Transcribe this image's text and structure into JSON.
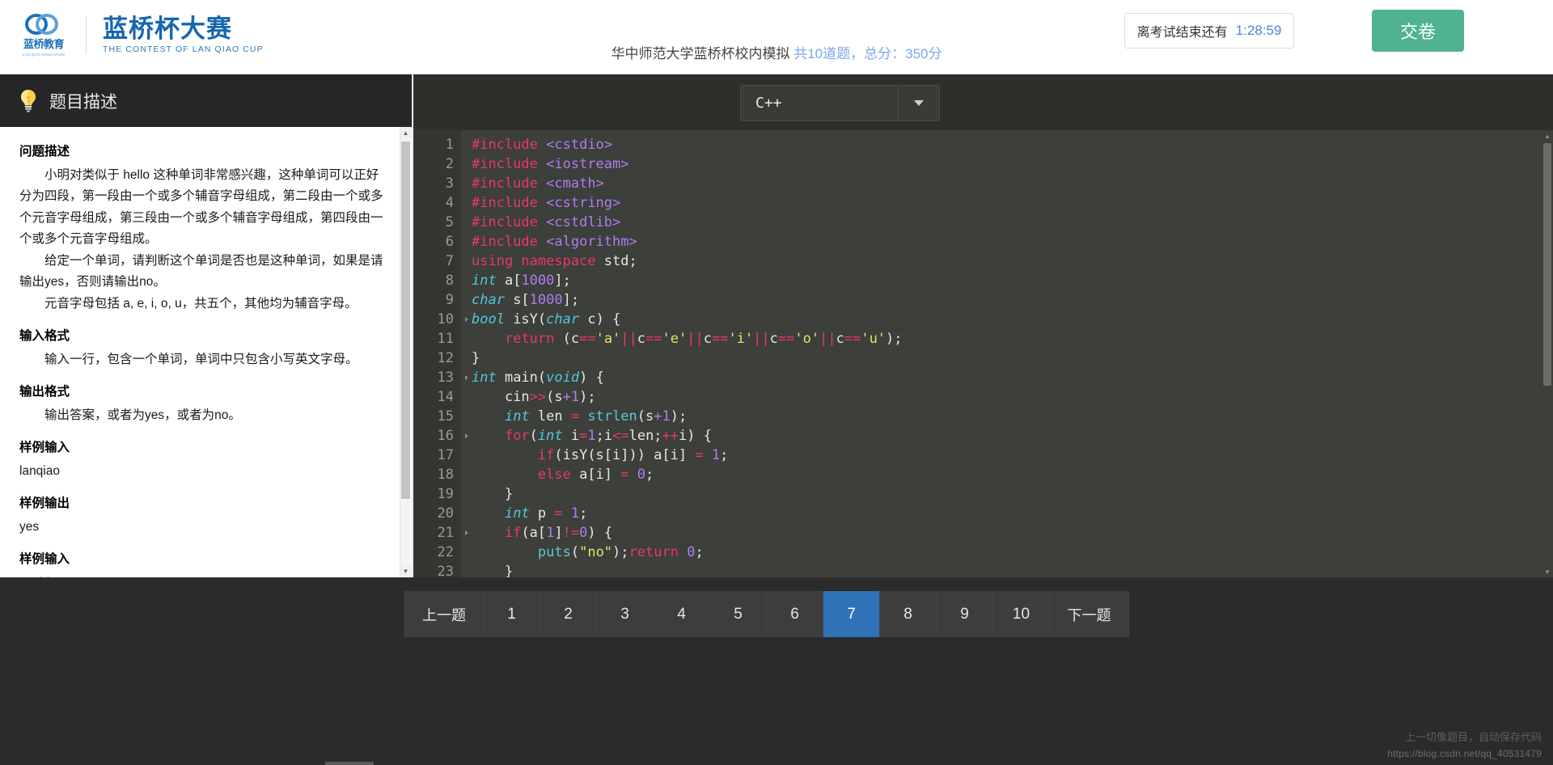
{
  "header": {
    "logo_cn": "蓝桥教育",
    "logo_en_small": "LAN QIAO EDUCATION",
    "brand_title": "蓝桥杯大赛",
    "brand_subtitle": "THE CONTEST OF LAN QIAO CUP",
    "subtitle_main": "华中师范大学蓝桥杯校内模拟",
    "subtitle_meta": "共10道题，总分：350分",
    "timer_label": "离考试结束还有",
    "timer_value": "1:28:59",
    "submit_label": "交卷"
  },
  "left": {
    "panel_title": "题目描述",
    "sections": [
      {
        "title": "问题描述",
        "paras": [
          "小明对类似于 hello 这种单词非常感兴趣，这种单词可以正好分为四段，第一段由一个或多个辅音字母组成，第二段由一个或多个元音字母组成，第三段由一个或多个辅音字母组成，第四段由一个或多个元音字母组成。",
          "给定一个单词，请判断这个单词是否也是这种单词，如果是请输出yes，否则请输出no。",
          "元音字母包括 a, e, i, o, u，共五个，其他均为辅音字母。"
        ]
      },
      {
        "title": "输入格式",
        "paras": [
          "输入一行，包含一个单词，单词中只包含小写英文字母。"
        ]
      },
      {
        "title": "输出格式",
        "paras": [
          "输出答案，或者为yes，或者为no。"
        ]
      },
      {
        "title": "样例输入",
        "plain": [
          "lanqiao"
        ]
      },
      {
        "title": "样例输出",
        "plain": [
          "yes"
        ]
      },
      {
        "title": "样例输入",
        "plain": [
          "world"
        ]
      }
    ]
  },
  "editor": {
    "language": "C++",
    "lines": [
      {
        "n": 1,
        "fold": false,
        "tokens": [
          {
            "c": "k",
            "t": "#include"
          },
          {
            "c": "p",
            "t": " "
          },
          {
            "c": "h",
            "t": "<cstdio>"
          }
        ]
      },
      {
        "n": 2,
        "fold": false,
        "tokens": [
          {
            "c": "k",
            "t": "#include"
          },
          {
            "c": "p",
            "t": " "
          },
          {
            "c": "h",
            "t": "<iostream>"
          }
        ]
      },
      {
        "n": 3,
        "fold": false,
        "tokens": [
          {
            "c": "k",
            "t": "#include"
          },
          {
            "c": "p",
            "t": " "
          },
          {
            "c": "h",
            "t": "<cmath>"
          }
        ]
      },
      {
        "n": 4,
        "fold": false,
        "tokens": [
          {
            "c": "k",
            "t": "#include"
          },
          {
            "c": "p",
            "t": " "
          },
          {
            "c": "h",
            "t": "<cstring>"
          }
        ]
      },
      {
        "n": 5,
        "fold": false,
        "tokens": [
          {
            "c": "k",
            "t": "#include"
          },
          {
            "c": "p",
            "t": " "
          },
          {
            "c": "h",
            "t": "<cstdlib>"
          }
        ]
      },
      {
        "n": 6,
        "fold": false,
        "tokens": [
          {
            "c": "k",
            "t": "#include"
          },
          {
            "c": "p",
            "t": " "
          },
          {
            "c": "h",
            "t": "<algorithm>"
          }
        ]
      },
      {
        "n": 7,
        "fold": false,
        "tokens": [
          {
            "c": "k",
            "t": "using namespace"
          },
          {
            "c": "p",
            "t": " std;"
          }
        ]
      },
      {
        "n": 8,
        "fold": false,
        "tokens": [
          {
            "c": "t",
            "t": "int"
          },
          {
            "c": "p",
            "t": " a["
          },
          {
            "c": "n",
            "t": "1000"
          },
          {
            "c": "p",
            "t": "];"
          }
        ]
      },
      {
        "n": 9,
        "fold": false,
        "tokens": [
          {
            "c": "t",
            "t": "char"
          },
          {
            "c": "p",
            "t": " s["
          },
          {
            "c": "n",
            "t": "1000"
          },
          {
            "c": "p",
            "t": "];"
          }
        ]
      },
      {
        "n": 10,
        "fold": true,
        "tokens": [
          {
            "c": "t",
            "t": "bool"
          },
          {
            "c": "p",
            "t": " isY("
          },
          {
            "c": "t",
            "t": "char"
          },
          {
            "c": "p",
            "t": " c) {"
          }
        ]
      },
      {
        "n": 11,
        "fold": false,
        "tokens": [
          {
            "c": "p",
            "t": "    "
          },
          {
            "c": "k",
            "t": "return"
          },
          {
            "c": "p",
            "t": " (c"
          },
          {
            "c": "o",
            "t": "=="
          },
          {
            "c": "s",
            "t": "'a'"
          },
          {
            "c": "o",
            "t": "||"
          },
          {
            "c": "p",
            "t": "c"
          },
          {
            "c": "o",
            "t": "=="
          },
          {
            "c": "s",
            "t": "'e'"
          },
          {
            "c": "o",
            "t": "||"
          },
          {
            "c": "p",
            "t": "c"
          },
          {
            "c": "o",
            "t": "=="
          },
          {
            "c": "s",
            "t": "'i'"
          },
          {
            "c": "o",
            "t": "||"
          },
          {
            "c": "p",
            "t": "c"
          },
          {
            "c": "o",
            "t": "=="
          },
          {
            "c": "s",
            "t": "'o'"
          },
          {
            "c": "o",
            "t": "||"
          },
          {
            "c": "p",
            "t": "c"
          },
          {
            "c": "o",
            "t": "=="
          },
          {
            "c": "s",
            "t": "'u'"
          },
          {
            "c": "p",
            "t": ");"
          }
        ]
      },
      {
        "n": 12,
        "fold": false,
        "tokens": [
          {
            "c": "p",
            "t": "}"
          }
        ]
      },
      {
        "n": 13,
        "fold": true,
        "tokens": [
          {
            "c": "t",
            "t": "int"
          },
          {
            "c": "p",
            "t": " main("
          },
          {
            "c": "t",
            "t": "void"
          },
          {
            "c": "p",
            "t": ") {"
          }
        ]
      },
      {
        "n": 14,
        "fold": false,
        "tokens": [
          {
            "c": "p",
            "t": "    cin"
          },
          {
            "c": "o",
            "t": ">>"
          },
          {
            "c": "p",
            "t": "(s"
          },
          {
            "c": "n",
            "t": "+1"
          },
          {
            "c": "p",
            "t": ");"
          }
        ]
      },
      {
        "n": 15,
        "fold": false,
        "tokens": [
          {
            "c": "p",
            "t": "    "
          },
          {
            "c": "t",
            "t": "int"
          },
          {
            "c": "p",
            "t": " len "
          },
          {
            "c": "o",
            "t": "="
          },
          {
            "c": "p",
            "t": " "
          },
          {
            "c": "f",
            "t": "strlen"
          },
          {
            "c": "p",
            "t": "(s"
          },
          {
            "c": "n",
            "t": "+1"
          },
          {
            "c": "p",
            "t": ");"
          }
        ]
      },
      {
        "n": 16,
        "fold": true,
        "tokens": [
          {
            "c": "p",
            "t": "    "
          },
          {
            "c": "k",
            "t": "for"
          },
          {
            "c": "p",
            "t": "("
          },
          {
            "c": "t",
            "t": "int"
          },
          {
            "c": "p",
            "t": " i"
          },
          {
            "c": "o",
            "t": "="
          },
          {
            "c": "n",
            "t": "1"
          },
          {
            "c": "p",
            "t": ";i"
          },
          {
            "c": "o",
            "t": "<="
          },
          {
            "c": "p",
            "t": "len;"
          },
          {
            "c": "o",
            "t": "++"
          },
          {
            "c": "p",
            "t": "i) {"
          }
        ]
      },
      {
        "n": 17,
        "fold": false,
        "tokens": [
          {
            "c": "p",
            "t": "        "
          },
          {
            "c": "k",
            "t": "if"
          },
          {
            "c": "p",
            "t": "(isY(s[i])) a[i] "
          },
          {
            "c": "o",
            "t": "="
          },
          {
            "c": "p",
            "t": " "
          },
          {
            "c": "n",
            "t": "1"
          },
          {
            "c": "p",
            "t": ";"
          }
        ]
      },
      {
        "n": 18,
        "fold": false,
        "tokens": [
          {
            "c": "p",
            "t": "        "
          },
          {
            "c": "k",
            "t": "else"
          },
          {
            "c": "p",
            "t": " a[i] "
          },
          {
            "c": "o",
            "t": "="
          },
          {
            "c": "p",
            "t": " "
          },
          {
            "c": "n",
            "t": "0"
          },
          {
            "c": "p",
            "t": ";"
          }
        ]
      },
      {
        "n": 19,
        "fold": false,
        "tokens": [
          {
            "c": "p",
            "t": "    }"
          }
        ]
      },
      {
        "n": 20,
        "fold": false,
        "tokens": [
          {
            "c": "p",
            "t": "    "
          },
          {
            "c": "t",
            "t": "int"
          },
          {
            "c": "p",
            "t": " p "
          },
          {
            "c": "o",
            "t": "="
          },
          {
            "c": "p",
            "t": " "
          },
          {
            "c": "n",
            "t": "1"
          },
          {
            "c": "p",
            "t": ";"
          }
        ]
      },
      {
        "n": 21,
        "fold": true,
        "tokens": [
          {
            "c": "p",
            "t": "    "
          },
          {
            "c": "k",
            "t": "if"
          },
          {
            "c": "p",
            "t": "(a["
          },
          {
            "c": "n",
            "t": "1"
          },
          {
            "c": "p",
            "t": "]"
          },
          {
            "c": "o",
            "t": "!="
          },
          {
            "c": "n",
            "t": "0"
          },
          {
            "c": "p",
            "t": ") {"
          }
        ]
      },
      {
        "n": 22,
        "fold": false,
        "tokens": [
          {
            "c": "p",
            "t": "        "
          },
          {
            "c": "f",
            "t": "puts"
          },
          {
            "c": "p",
            "t": "("
          },
          {
            "c": "s",
            "t": "\"no\""
          },
          {
            "c": "p",
            "t": ");"
          },
          {
            "c": "k",
            "t": "return"
          },
          {
            "c": "p",
            "t": " "
          },
          {
            "c": "n",
            "t": "0"
          },
          {
            "c": "p",
            "t": ";"
          }
        ]
      },
      {
        "n": 23,
        "fold": false,
        "tokens": [
          {
            "c": "p",
            "t": "    }"
          }
        ]
      }
    ]
  },
  "pager": {
    "prev_label": "上一题",
    "next_label": "下一题",
    "pages": [
      "1",
      "2",
      "3",
      "4",
      "5",
      "6",
      "7",
      "8",
      "9",
      "10"
    ],
    "active": "7"
  },
  "watermark": {
    "line1": "上一切像题目，自动保存代码",
    "line2": "https://blog.csdn.net/qq_40531479"
  },
  "colors": {
    "accent_blue": "#2f72b8",
    "brand_blue": "#1566b0",
    "submit_green": "#4fb38f",
    "editor_bg": "#3c3f3a",
    "gutter_bg": "#34362f"
  }
}
